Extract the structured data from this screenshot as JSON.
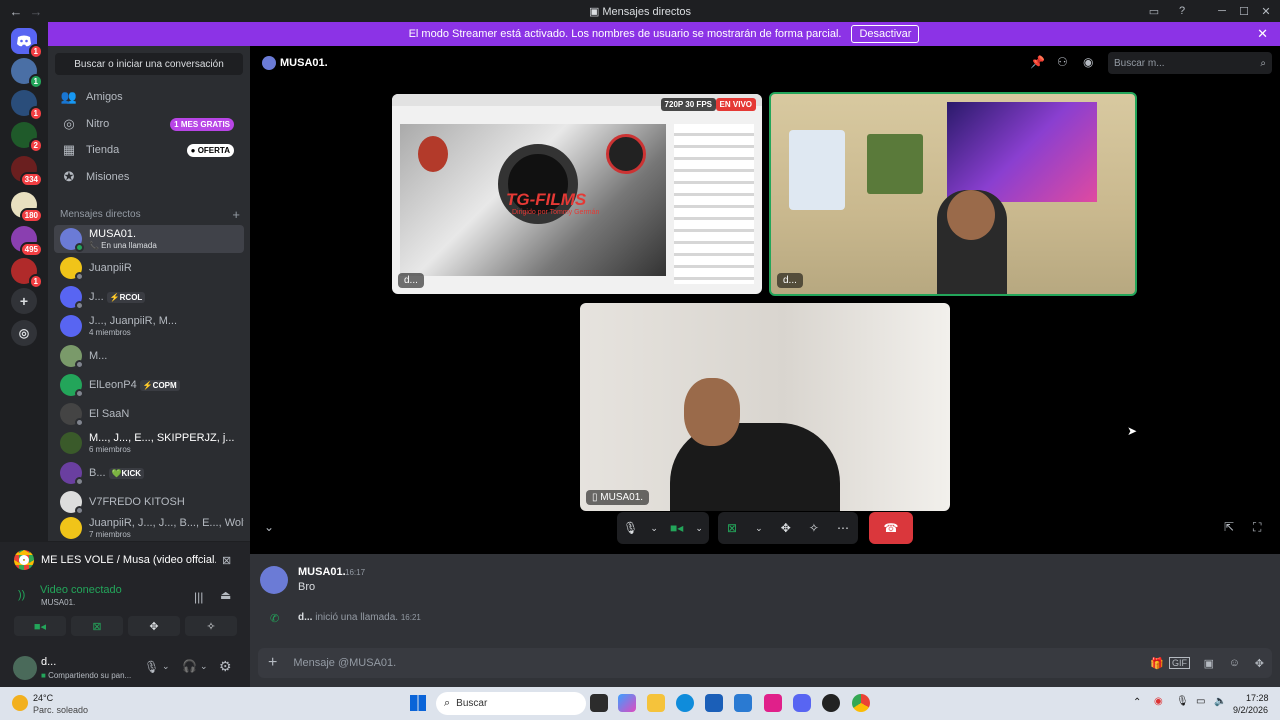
{
  "window": {
    "title": "Mensajes directos",
    "back": "←",
    "forward": "→"
  },
  "banner": {
    "text": "El modo Streamer está activado. Los nombres de usuario se mostrarán de forma parcial.",
    "button": "Desactivar",
    "close": "✕",
    "color": "#8c33e6"
  },
  "rail": {
    "servers": [
      {
        "badge": "1"
      },
      {
        "badge": "1"
      },
      {
        "badge": "1"
      },
      {
        "badge": "2"
      },
      {
        "badge": "334"
      },
      {
        "badge": "180"
      },
      {
        "badge": "495"
      },
      {
        "badge": "1"
      }
    ]
  },
  "sidebar": {
    "search": "Buscar o iniciar una conversación",
    "nav": [
      {
        "label": "Amigos",
        "icon": "👥"
      },
      {
        "label": "Nitro",
        "icon": "◎",
        "pill": "1 MES GRATIS",
        "pill_color": "#b845e6"
      },
      {
        "label": "Tienda",
        "icon": "▦",
        "pill": "● OFERTA",
        "pill_color": "#ffffff"
      },
      {
        "label": "Misiones",
        "icon": "✪"
      }
    ],
    "dm_header": "Mensajes directos",
    "dm_add": "+",
    "dms": [
      {
        "name": "MUSA01.",
        "sub": "📞 En una llamada",
        "active": true,
        "color": "#6b7bd6"
      },
      {
        "name": "JuanpiiR",
        "color": "#f0c419"
      },
      {
        "name": "J...",
        "tag": "⚡RCOL",
        "tag_color": "#3a3c42",
        "color": "#5865f2"
      },
      {
        "name": "J..., JuanpiiR, M...",
        "sub": "4 miembros",
        "color": "#5865f2"
      },
      {
        "name": "M...",
        "color": "#7a9a6a"
      },
      {
        "name": "ElLeonP4",
        "tag": "⚡COPM",
        "tag_color": "#3a3c42",
        "color": "#23a55a"
      },
      {
        "name": "El SaaN",
        "color": "#444"
      },
      {
        "name": "M..., J..., E..., SKIPPERJZ, j...",
        "sub": "6 miembros",
        "color": "#3a5a2a"
      },
      {
        "name": "B...",
        "tag": "💚KICK",
        "tag_color": "#3a3c42",
        "color": "#6a3fa0"
      },
      {
        "name": "V7FREDO KITOSH",
        "color": "#ddd"
      },
      {
        "name": "JuanpiiR, J..., J..., B..., E..., Wolf...",
        "sub": "7 miembros",
        "color": "#f0c419"
      }
    ]
  },
  "rtc": {
    "activity": "ME LES VOLE / Musa (video offcial...",
    "status": "Video conectado",
    "channel": "MUSA01.",
    "user": "d...",
    "user_status": "Compartiendo su pan..."
  },
  "chat": {
    "recipient": "MUSA01.",
    "search_placeholder": "Buscar m...",
    "tiles": [
      {
        "label": "d...",
        "badge_quality": "720P 30 FPS",
        "badge_live": "EN VIVO",
        "video_title": "TG-FILMS",
        "video_sub": "Dirigido por Tommy Germán"
      },
      {
        "label": "d..."
      },
      {
        "label": "MUSA01."
      }
    ],
    "messages": [
      {
        "author": "MUSA01.",
        "time": "16:17",
        "text": "Bro"
      }
    ],
    "call_event": {
      "actor": "d...",
      "text": "inició una llamada.",
      "time": "16:21"
    },
    "composer_placeholder": "Mensaje @MUSA01."
  },
  "taskbar": {
    "weather_temp": "24°C",
    "weather_desc": "Parc. soleado",
    "search": "Buscar",
    "time": "17:28",
    "date": "9/2/2026"
  }
}
